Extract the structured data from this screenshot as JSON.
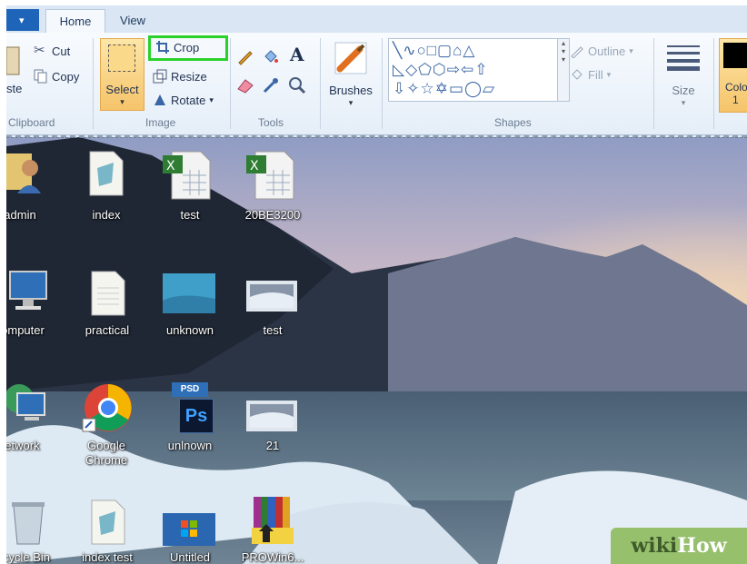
{
  "tabs": [
    {
      "label": "Home"
    },
    {
      "label": "View"
    }
  ],
  "ribbon": {
    "clipboard": {
      "paste_label": "ste",
      "cut_label": "Cut",
      "copy_label": "Copy",
      "group_label": "Clipboard"
    },
    "image": {
      "select_label": "Select",
      "crop_label": "Crop",
      "resize_label": "Resize",
      "rotate_label": "Rotate",
      "group_label": "Image"
    },
    "tools": {
      "group_label": "Tools"
    },
    "brushes": {
      "label": "Brushes"
    },
    "shapes": {
      "outline_label": "Outline",
      "fill_label": "Fill",
      "group_label": "Shapes"
    },
    "size": {
      "label": "Size"
    },
    "color1": {
      "label_line1": "Colo",
      "label_line2": "1"
    }
  },
  "desktop": {
    "icons": [
      {
        "label": "admin",
        "kind": "user"
      },
      {
        "label": "index",
        "kind": "doc"
      },
      {
        "label": "test",
        "kind": "excel"
      },
      {
        "label": "20BE3200",
        "kind": "excel"
      },
      {
        "label": "omputer",
        "kind": "computer"
      },
      {
        "label": "practical",
        "kind": "doc"
      },
      {
        "label": "unknown",
        "kind": "image"
      },
      {
        "label": "test",
        "kind": "photo"
      },
      {
        "label": "letwork",
        "kind": "network"
      },
      {
        "label": "Google Chrome",
        "kind": "chrome"
      },
      {
        "label": "unlnown",
        "kind": "photoshop",
        "badge": "PSD",
        "badge2": "Ps"
      },
      {
        "label": "21",
        "kind": "photo"
      },
      {
        "label": "cycle Bin",
        "kind": "recycle"
      },
      {
        "label": "index test",
        "kind": "doc"
      },
      {
        "label": "Untitled",
        "kind": "windows"
      },
      {
        "label": "PROWin6...",
        "kind": "winrar"
      }
    ]
  },
  "watermark": {
    "part1": "wiki",
    "part2": "How"
  }
}
